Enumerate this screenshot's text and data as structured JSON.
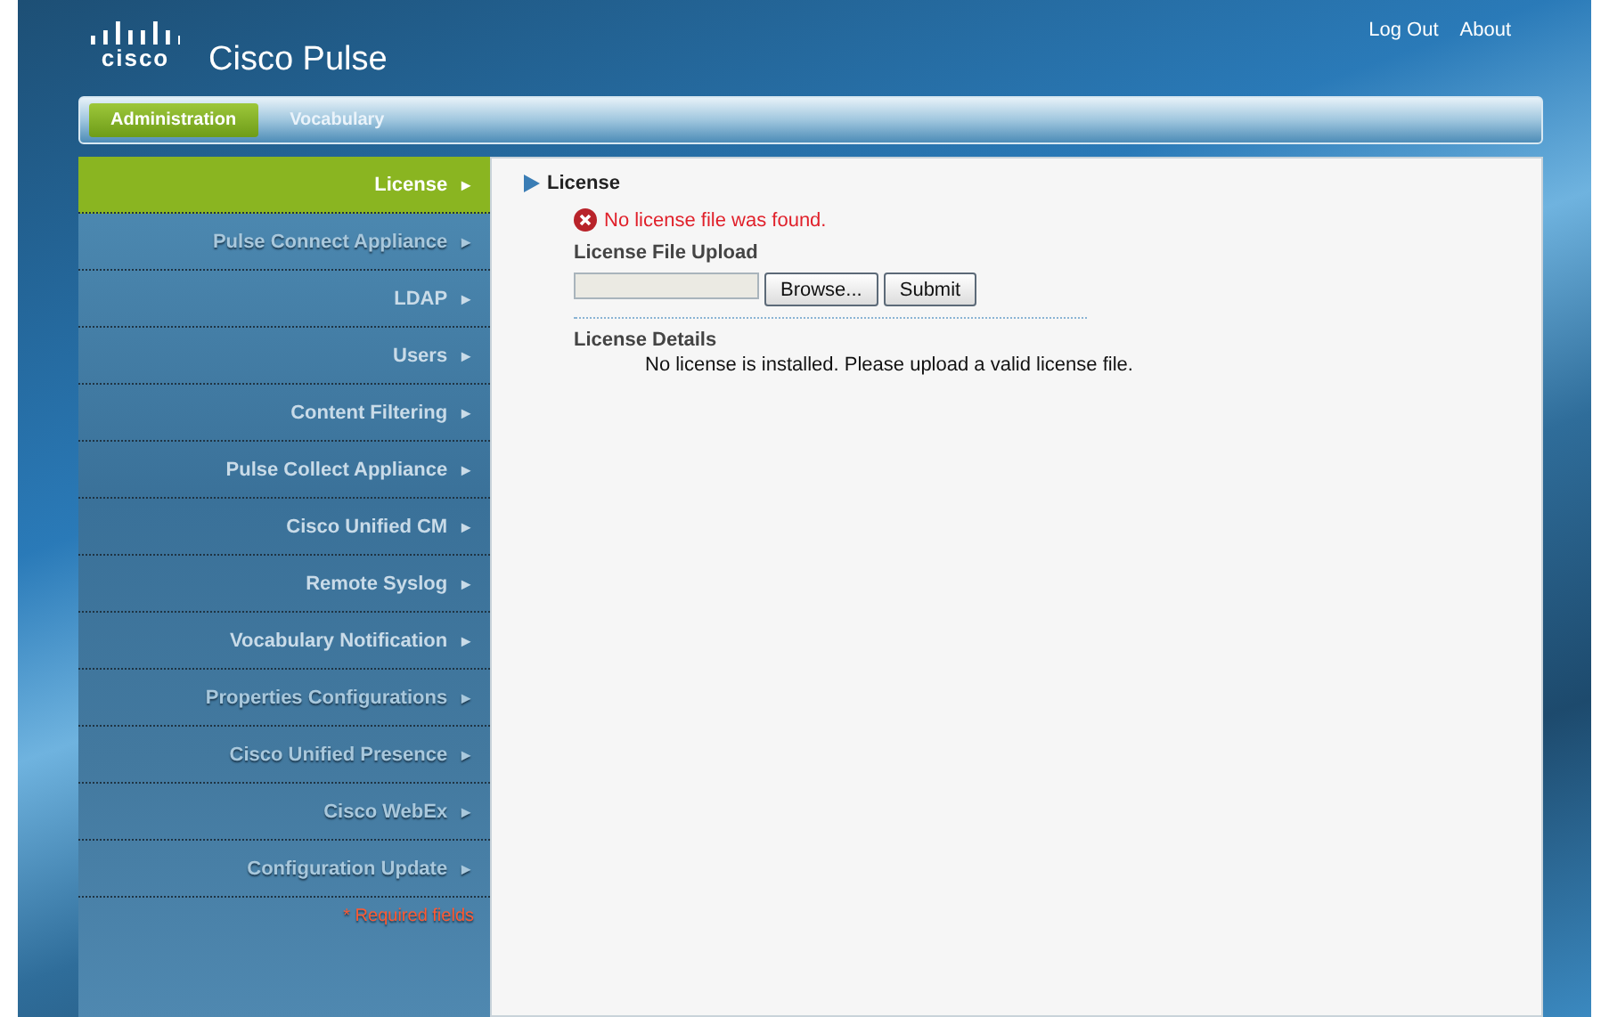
{
  "header": {
    "logo_text": "cisco",
    "app_title": "Cisco Pulse",
    "links": [
      "Log Out",
      "About"
    ]
  },
  "tabs": [
    {
      "label": "Administration",
      "selected": true
    },
    {
      "label": "Vocabulary",
      "selected": false
    }
  ],
  "sidebar": {
    "items": [
      {
        "label": "License",
        "arrow": "►",
        "selected": true,
        "disabled": false
      },
      {
        "label": "Pulse Connect Appliance",
        "arrow": "►",
        "selected": false,
        "disabled": true
      },
      {
        "label": "LDAP",
        "arrow": "►",
        "selected": false,
        "disabled": false
      },
      {
        "label": "Users",
        "arrow": "►",
        "selected": false,
        "disabled": false
      },
      {
        "label": "Content Filtering",
        "arrow": "►",
        "selected": false,
        "disabled": false
      },
      {
        "label": "Pulse Collect Appliance",
        "arrow": "►",
        "selected": false,
        "disabled": false
      },
      {
        "label": "Cisco Unified CM",
        "arrow": "►",
        "selected": false,
        "disabled": false
      },
      {
        "label": "Remote Syslog",
        "arrow": "►",
        "selected": false,
        "disabled": false
      },
      {
        "label": "Vocabulary Notification",
        "arrow": "►",
        "selected": false,
        "disabled": false
      },
      {
        "label": "Properties Configurations",
        "arrow": "►",
        "selected": false,
        "disabled": true
      },
      {
        "label": "Cisco Unified Presence",
        "arrow": "►",
        "selected": false,
        "disabled": true
      },
      {
        "label": "Cisco WebEx",
        "arrow": "►",
        "selected": false,
        "disabled": true
      },
      {
        "label": "Configuration Update",
        "arrow": "►",
        "selected": false,
        "disabled": true
      }
    ],
    "required_note": "* Required fields"
  },
  "content": {
    "title": "License",
    "error": "No license file was found.",
    "upload_label": "License File Upload",
    "browse_button": "Browse...",
    "submit_button": "Submit",
    "details_label": "License Details",
    "details_text": "No license is installed. Please upload a valid license file."
  }
}
